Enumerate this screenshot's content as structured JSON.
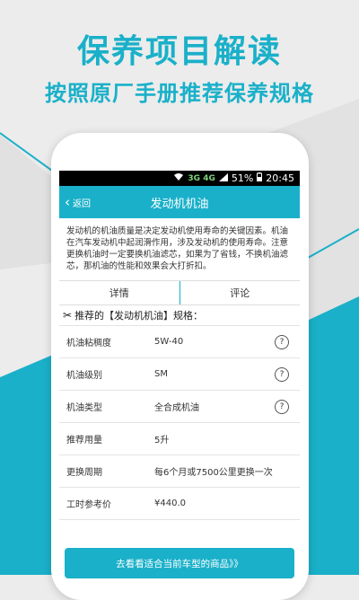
{
  "promo": {
    "title": "保养项目解读",
    "subtitle": "按照原厂手册推荐保养规格"
  },
  "statusbar": {
    "network": "3G 4G",
    "battery": "51%",
    "time": "20:45"
  },
  "appbar": {
    "back_label": "返回",
    "title": "发动机机油"
  },
  "intro": "发动机的机油质量是决定发动机使用寿命的关键因素。机油在汽车发动机中起润滑作用，涉及发动机的使用寿命。注意更换机油时一定要换机油滤芯，如果为了省钱，不换机油滤芯，那机油的性能和效果会大打折扣。",
  "tabs": [
    "详情",
    "评论"
  ],
  "spec_header": "推荐的【发动机机油】规格：",
  "specs": [
    {
      "label": "机油粘稠度",
      "value": "5W-40",
      "help": "?"
    },
    {
      "label": "机油级别",
      "value": "SM",
      "help": "?"
    },
    {
      "label": "机油类型",
      "value": "全合成机油",
      "help": "?"
    },
    {
      "label": "推荐用量",
      "value": "5升",
      "help": ""
    },
    {
      "label": "更换周期",
      "value": "每6个月或7500公里更换一次",
      "help": ""
    },
    {
      "label": "工时参考价",
      "value": "¥440.0",
      "help": ""
    }
  ],
  "cta_label": "去看看适合当前车型的商品》》",
  "colors": {
    "accent": "#1ab0c9",
    "background": "#ececec"
  }
}
